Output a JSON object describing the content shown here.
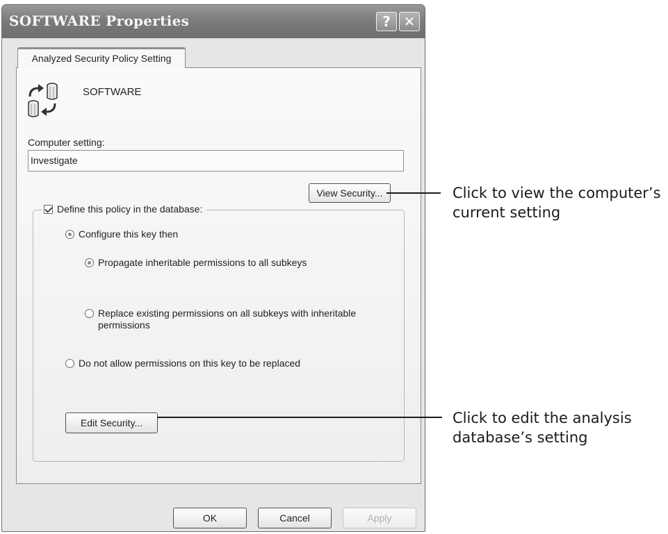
{
  "window": {
    "title": "SOFTWARE Properties",
    "help_glyph": "?",
    "close_glyph": "✕"
  },
  "tabs": [
    {
      "label": "Analyzed Security Policy Setting",
      "active": true
    }
  ],
  "policy": {
    "icon": "registry-key-icon",
    "key_name": "SOFTWARE",
    "computer_setting_label": "Computer setting:",
    "computer_setting_value": "Investigate",
    "view_security_label": "View Security...",
    "define_checkbox_label": "Define this policy in the database:",
    "define_checked": true,
    "options": [
      {
        "label": "Configure this key then",
        "selected": true
      },
      {
        "label": "Propagate inheritable permissions to all subkeys",
        "selected": true
      },
      {
        "label": "Replace existing permissions on all subkeys with inheritable permissions",
        "selected": false
      },
      {
        "label": "Do not allow permissions on this key to be replaced",
        "selected": false
      }
    ],
    "edit_security_label": "Edit Security..."
  },
  "footer": {
    "ok_label": "OK",
    "cancel_label": "Cancel",
    "apply_label": "Apply",
    "apply_enabled": false
  },
  "callouts": [
    {
      "text_line1": "Click to view the computer’s",
      "text_line2": "current setting"
    },
    {
      "text_line1": "Click to edit the analysis",
      "text_line2": "database’s setting"
    }
  ]
}
